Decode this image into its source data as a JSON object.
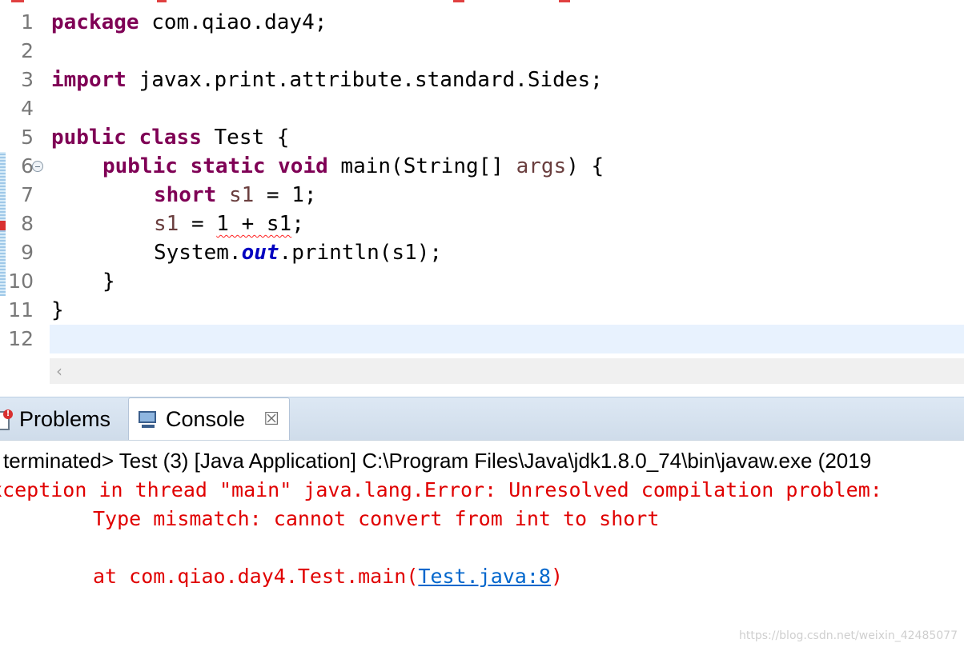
{
  "editor": {
    "line_numbers": [
      "1",
      "2",
      "3",
      "4",
      "5",
      "6",
      "7",
      "8",
      "9",
      "10",
      "11",
      "12"
    ],
    "lines": {
      "l1": {
        "kw": "package",
        "rest": " com.qiao.day4;"
      },
      "l3": {
        "kw": "import",
        "rest": " javax.print.attribute.standard.Sides;"
      },
      "l5": {
        "kw1": "public",
        "kw2": "class",
        "rest": " Test {"
      },
      "l6": {
        "kw1": "public",
        "kw2": "static",
        "kw3": "void",
        "pre": " main(String[] ",
        "var": "args",
        "post": ") {"
      },
      "l7": {
        "kw": "short",
        "var": "s1",
        "post": " = 1;"
      },
      "l8": {
        "var": "s1",
        "mid": " = ",
        "err": "1 + s1",
        "post": ";"
      },
      "l9": {
        "pre": "System.",
        "field": "out",
        "post": ".println(s1);"
      },
      "l10": {
        "text": "}"
      },
      "l11": {
        "text": "}"
      }
    },
    "scroll_left_glyph": "‹"
  },
  "tabs": {
    "problems": "Problems",
    "console": "Console",
    "close_glyph": "☒"
  },
  "console": {
    "header": "terminated> Test (3) [Java Application] C:\\Program Files\\Java\\jdk1.8.0_74\\bin\\javaw.exe (2019",
    "line1": "xception in thread \"main\" java.lang.Error: Unresolved compilation problem: ",
    "line2": "Type mismatch: cannot convert from int to short",
    "line3_pre": "at com.qiao.day4.Test.main(",
    "line3_link": "Test.java:8",
    "line3_post": ")"
  },
  "watermark": "https://blog.csdn.net/weixin_42485077",
  "colors": {
    "keyword": "#7f0055",
    "variable": "#6a3e3e",
    "static_field": "#0000c0",
    "error_text": "#e00000",
    "link": "#0066cc",
    "current_line": "#e8f2fe"
  }
}
